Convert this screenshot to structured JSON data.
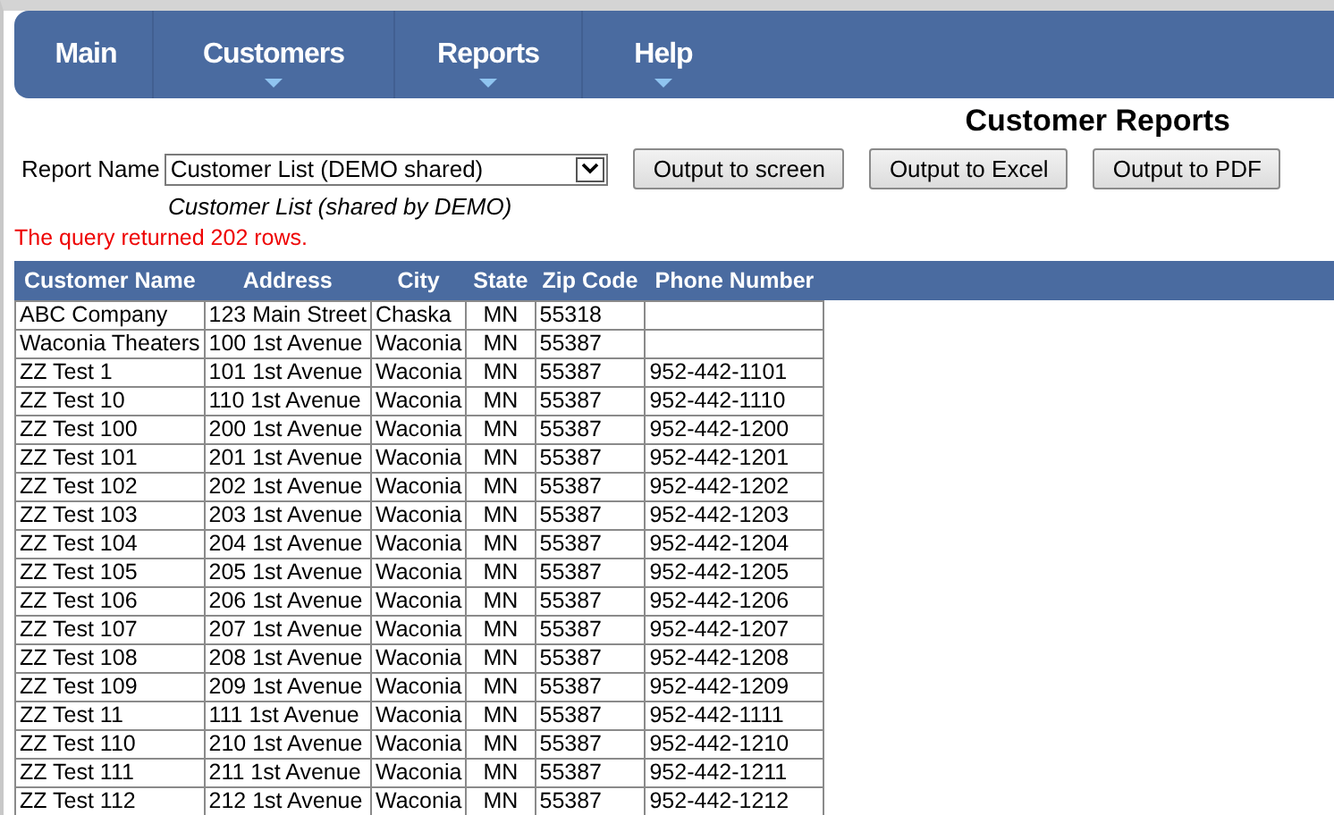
{
  "nav": [
    {
      "label": "Main",
      "has_menu": false
    },
    {
      "label": "Customers",
      "has_menu": true
    },
    {
      "label": "Reports",
      "has_menu": true
    },
    {
      "label": "Help",
      "has_menu": true
    }
  ],
  "page_title": "Customer Reports",
  "report": {
    "label": "Report Name",
    "value": "Customer List (DEMO shared)",
    "description": "Customer List (shared by DEMO)"
  },
  "buttons": [
    "Output to screen",
    "Output to Excel",
    "Output to PDF"
  ],
  "message": "The query returned 202 rows.",
  "table": {
    "columns": [
      "Customer Name",
      "Address",
      "City",
      "State",
      "Zip Code",
      "Phone Number"
    ],
    "rows": [
      [
        "ABC Company",
        "123 Main Street",
        "Chaska",
        "MN",
        "55318",
        ""
      ],
      [
        "Waconia Theaters",
        "100 1st Avenue",
        "Waconia",
        "MN",
        "55387",
        ""
      ],
      [
        "ZZ Test 1",
        "101 1st Avenue",
        "Waconia",
        "MN",
        "55387",
        "952-442-1101"
      ],
      [
        "ZZ Test 10",
        "110 1st Avenue",
        "Waconia",
        "MN",
        "55387",
        "952-442-1110"
      ],
      [
        "ZZ Test 100",
        "200 1st Avenue",
        "Waconia",
        "MN",
        "55387",
        "952-442-1200"
      ],
      [
        "ZZ Test 101",
        "201 1st Avenue",
        "Waconia",
        "MN",
        "55387",
        "952-442-1201"
      ],
      [
        "ZZ Test 102",
        "202 1st Avenue",
        "Waconia",
        "MN",
        "55387",
        "952-442-1202"
      ],
      [
        "ZZ Test 103",
        "203 1st Avenue",
        "Waconia",
        "MN",
        "55387",
        "952-442-1203"
      ],
      [
        "ZZ Test 104",
        "204 1st Avenue",
        "Waconia",
        "MN",
        "55387",
        "952-442-1204"
      ],
      [
        "ZZ Test 105",
        "205 1st Avenue",
        "Waconia",
        "MN",
        "55387",
        "952-442-1205"
      ],
      [
        "ZZ Test 106",
        "206 1st Avenue",
        "Waconia",
        "MN",
        "55387",
        "952-442-1206"
      ],
      [
        "ZZ Test 107",
        "207 1st Avenue",
        "Waconia",
        "MN",
        "55387",
        "952-442-1207"
      ],
      [
        "ZZ Test 108",
        "208 1st Avenue",
        "Waconia",
        "MN",
        "55387",
        "952-442-1208"
      ],
      [
        "ZZ Test 109",
        "209 1st Avenue",
        "Waconia",
        "MN",
        "55387",
        "952-442-1209"
      ],
      [
        "ZZ Test 11",
        "111 1st Avenue",
        "Waconia",
        "MN",
        "55387",
        "952-442-1111"
      ],
      [
        "ZZ Test 110",
        "210 1st Avenue",
        "Waconia",
        "MN",
        "55387",
        "952-442-1210"
      ],
      [
        "ZZ Test 111",
        "211 1st Avenue",
        "Waconia",
        "MN",
        "55387",
        "952-442-1211"
      ],
      [
        "ZZ Test 112",
        "212 1st Avenue",
        "Waconia",
        "MN",
        "55387",
        "952-442-1212"
      ]
    ]
  }
}
